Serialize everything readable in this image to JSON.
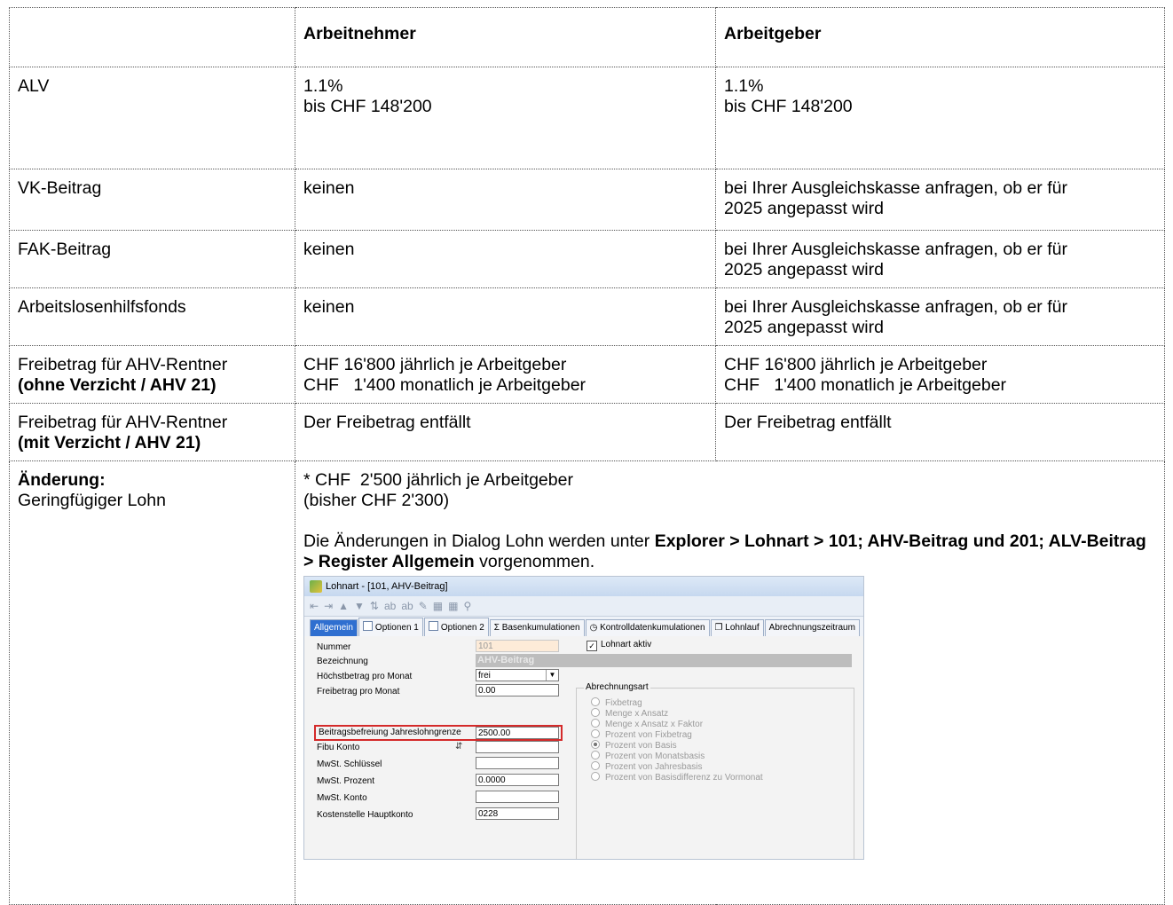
{
  "table": {
    "header": {
      "col1": "",
      "col2": "Arbeitnehmer",
      "col3": "Arbeitgeber"
    },
    "rows": [
      {
        "label": "ALV",
        "an": [
          "1.1%",
          "bis CHF 148'200"
        ],
        "ag": [
          "1.1%",
          "bis CHF 148'200"
        ]
      },
      {
        "label": "VK-Beitrag",
        "an": [
          "keinen"
        ],
        "ag": [
          "bei Ihrer Ausgleichskasse anfragen, ob er für",
          "2025 angepasst wird"
        ]
      },
      {
        "label": "FAK-Beitrag",
        "an": [
          "keinen"
        ],
        "ag": [
          "bei Ihrer Ausgleichskasse anfragen, ob er für",
          "2025 angepasst wird"
        ]
      },
      {
        "label": "Arbeitslosenhilfsfonds",
        "an": [
          "keinen"
        ],
        "ag": [
          "bei Ihrer Ausgleichskasse anfragen, ob er für",
          "2025 angepasst wird"
        ]
      },
      {
        "label": "Freibetrag für AHV-Rentner",
        "label_bold": "(ohne Verzicht / AHV 21)",
        "an": [
          "CHF 16'800 jährlich je Arbeitgeber",
          "CHF   1'400 monatlich je Arbeitgeber"
        ],
        "ag": [
          "CHF 16'800 jährlich je Arbeitgeber",
          "CHF   1'400 monatlich je Arbeitgeber"
        ]
      },
      {
        "label": "Freibetrag für AHV-Rentner",
        "label_bold": "(mit Verzicht / AHV 21)",
        "an": [
          "Der Freibetrag entfällt"
        ],
        "ag": [
          "Der Freibetrag entfällt"
        ]
      }
    ],
    "last_row": {
      "label_bold": "Änderung:",
      "label": "Geringfügiger Lohn",
      "line1": "* CHF  2'500 jährlich je Arbeitgeber",
      "line2": "(bisher CHF 2'300)",
      "p_start": "Die Änderungen in Dialog Lohn werden unter ",
      "p_bold": "Explorer > Lohnart > 101; AHV-Beitrag und 201; ALV-Beitrag > Register Allgemein",
      "p_end": " vorgenommen."
    }
  },
  "screenshot": {
    "title": "Lohnart - [101, AHV-Beitrag]",
    "tabs": [
      "Allgemein",
      "Optionen 1",
      "Optionen 2",
      "Basenkumulationen",
      "Kontrolldatenkumulationen",
      "Lohnlauf",
      "Abrechnungszeitraum"
    ],
    "fields": {
      "nummer": {
        "label": "Nummer",
        "value": "101"
      },
      "bezeichnung": {
        "label": "Bezeichnung",
        "value": "AHV-Beitrag"
      },
      "hoechst": {
        "label": "Höchstbetrag pro Monat",
        "value": "frei"
      },
      "freibetrag": {
        "label": "Freibetrag pro Monat",
        "value": "0.00"
      },
      "befreiung": {
        "label": "Beitragsbefreiung Jahreslohngrenze",
        "value": "2500.00"
      },
      "fibu": {
        "label": "Fibu Konto",
        "value": ""
      },
      "mwst_schl": {
        "label": "MwSt. Schlüssel",
        "value": ""
      },
      "mwst_proz": {
        "label": "MwSt. Prozent",
        "value": "0.0000"
      },
      "mwst_konto": {
        "label": "MwSt. Konto",
        "value": ""
      },
      "kst": {
        "label": "Kostenstelle Hauptkonto",
        "value": "0228"
      }
    },
    "lohnart_aktiv": "Lohnart aktiv",
    "group_label": "Abrechnungsart",
    "radios": [
      "Fixbetrag",
      "Menge x Ansatz",
      "Menge x Ansatz x Faktor",
      "Prozent von Fixbetrag",
      "Prozent von Basis",
      "Prozent von Monatsbasis",
      "Prozent von Jahresbasis",
      "Prozent von Basisdifferenz zu Vormonat"
    ]
  }
}
